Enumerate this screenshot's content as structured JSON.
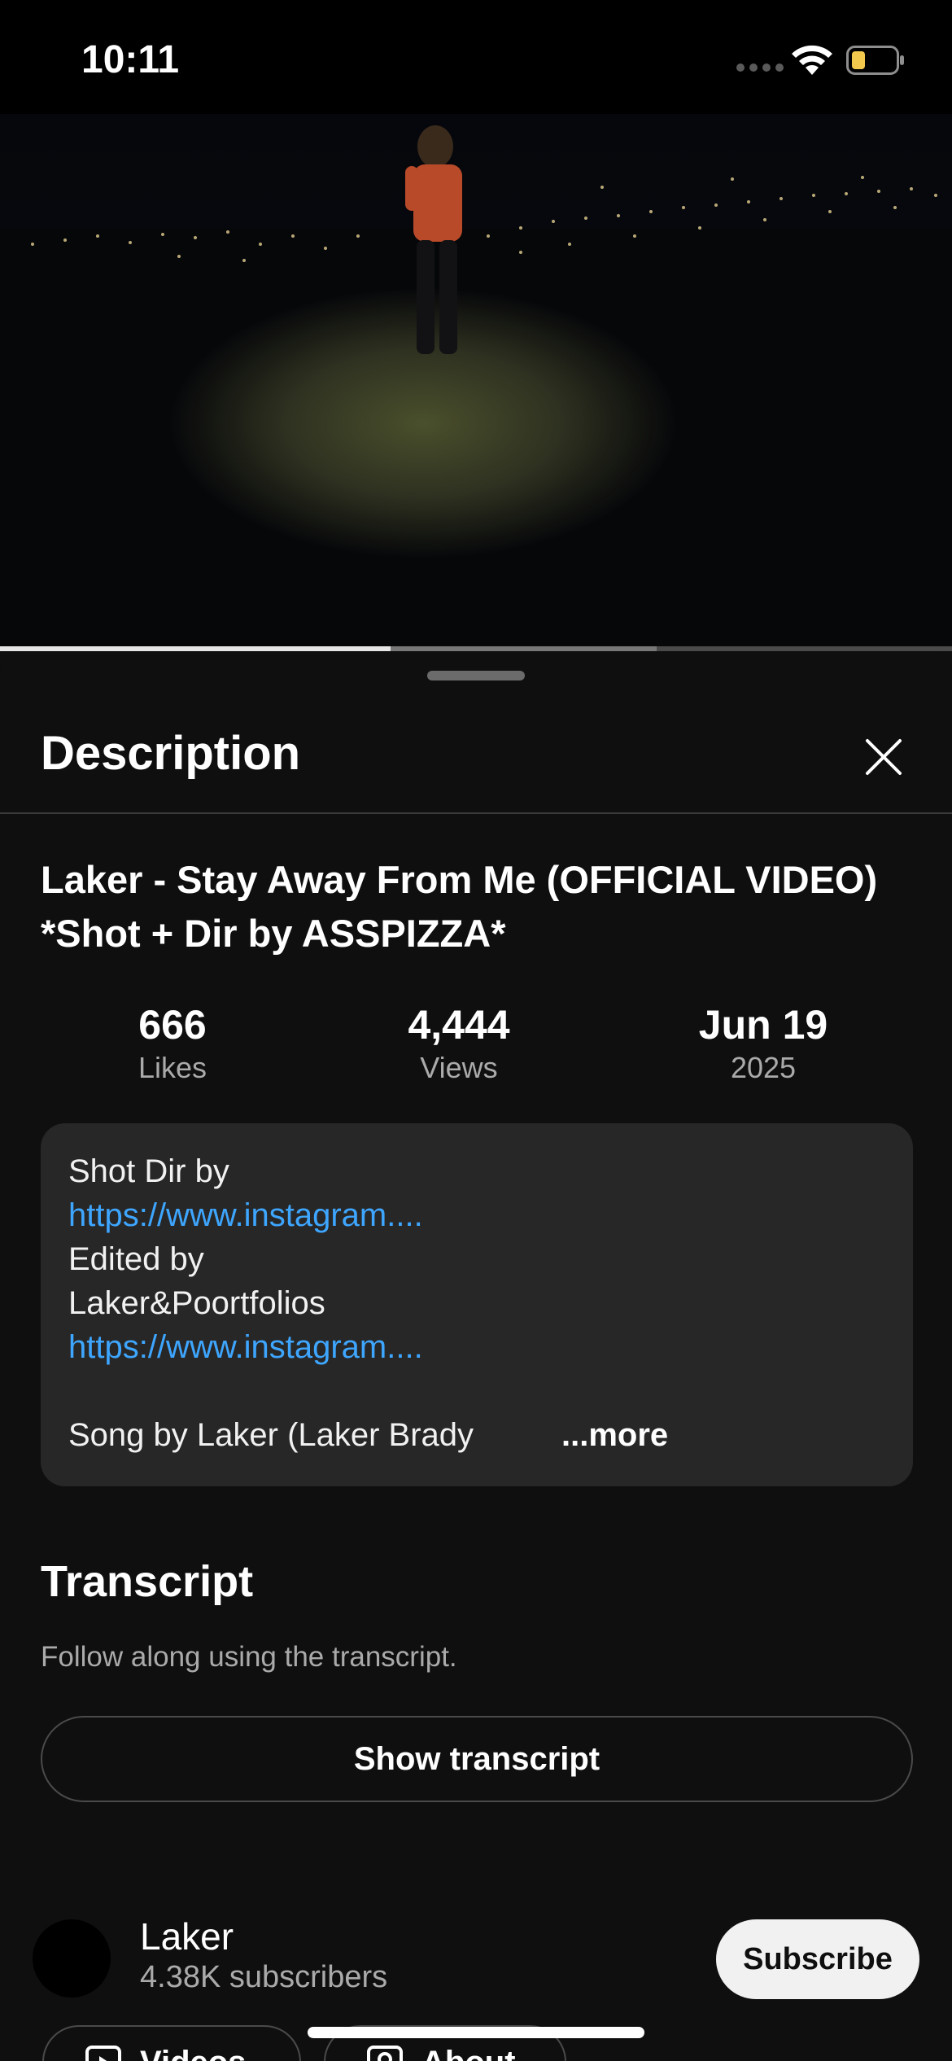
{
  "status_bar": {
    "time": "10:11",
    "icons": [
      "signal-icon",
      "wifi-icon",
      "battery-low-icon"
    ],
    "battery_color": "#f2c94c"
  },
  "player": {
    "progress_played": 0.41,
    "progress_buffered": 0.69
  },
  "panel": {
    "title": "Description",
    "close_icon": "close-icon"
  },
  "video": {
    "title": "Laker - Stay Away From Me (OFFICIAL VIDEO) *Shot + Dir by ASSPIZZA*",
    "stats": [
      {
        "value": "666",
        "label": "Likes"
      },
      {
        "value": "4,444",
        "label": "Views"
      },
      {
        "value": "Jun 19",
        "label": "2025"
      }
    ]
  },
  "description": {
    "lines": [
      {
        "text": "Shot Dir by",
        "link": false
      },
      {
        "text": "https://www.instagram....",
        "link": true
      },
      {
        "text": "Edited by",
        "link": false
      },
      {
        "text": "Laker&Poortfolios",
        "link": false
      },
      {
        "text": "https://www.instagram....",
        "link": true
      },
      {
        "text": "",
        "link": false
      }
    ],
    "last_line": "Song by Laker (Laker Brady",
    "more_label": "...more",
    "link_color": "#3ea6ff"
  },
  "transcript": {
    "title": "Transcript",
    "subtitle": "Follow along using the transcript.",
    "button_label": "Show transcript"
  },
  "channel": {
    "name": "Laker",
    "subscribers": "4.38K subscribers",
    "subscribe_label": "Subscribe"
  },
  "chips": [
    {
      "label": "Videos",
      "icon": "video-icon"
    },
    {
      "label": "About",
      "icon": "person-icon"
    }
  ]
}
